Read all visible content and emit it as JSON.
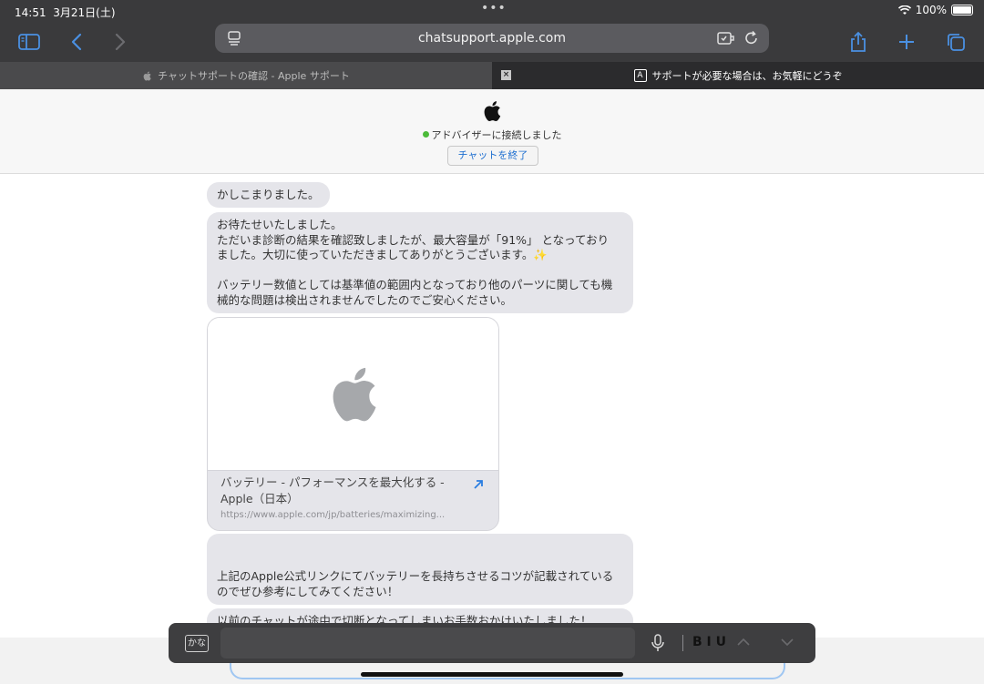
{
  "status_bar": {
    "time": "14:51",
    "date": "3月21日(土)",
    "dots": "•••",
    "battery": "100%"
  },
  "toolbar": {
    "url": "chatsupport.apple.com"
  },
  "tabs": [
    {
      "label": "チャットサポートの確認 - Apple サポート"
    },
    {
      "label": "サポートが必要な場合は、お気軽にどうぞ",
      "reader_icon": "A"
    }
  ],
  "header": {
    "status": "アドバイザーに接続しました",
    "end_button": "チャットを終了"
  },
  "messages": [
    {
      "text": "かしこまりました。"
    },
    {
      "text": "お待たせいたしました。\nただいま診断の結果を確認致しましたが、最大容量が「91%」 となっており\nました。大切に使っていただきましてありがとうございます。✨\n\nバッテリー数値としては基準値の範囲内となっており他のパーツに関しても機\n械的な問題は検出されませんでしたのでご安心ください。"
    },
    {
      "text": "\n\n上記のApple公式リンクにてバッテリーを長持ちさせるコツが記載されている\nのでぜひ参考にしてみてください！"
    },
    {
      "text": "以前のチャットが途中で切断となってしまいお手数おかけいたしました！"
    }
  ],
  "link_card": {
    "title": "バッテリー - パフォーマンスを最大化する - Apple（日本）",
    "url": "https://www.apple.com/jp/batteries/maximizing..."
  },
  "keyboard_bar": {
    "kana": "かな",
    "format": "B I U"
  },
  "colors": {
    "accent": "#4a90e2",
    "bubble": "#e5e5ea",
    "connected_dot": "#4cbb3a"
  }
}
